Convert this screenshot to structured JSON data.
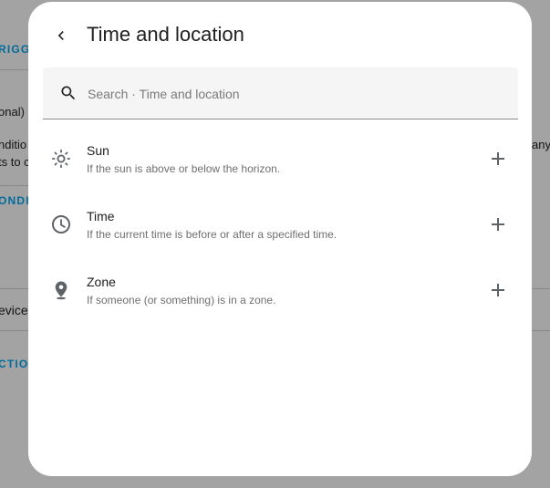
{
  "background": {
    "fragments": [
      {
        "text": "RIGGE"
      },
      {
        "text": "onal)"
      },
      {
        "text": "nditio"
      },
      {
        "text": "ts to c"
      },
      {
        "text": "ONDIT"
      },
      {
        "text": "evice"
      },
      {
        "text": "CTION"
      },
      {
        "text": "any"
      }
    ]
  },
  "dialog": {
    "title": "Time and location",
    "search": {
      "placeholder": "Search · Time and location",
      "value": ""
    },
    "items": [
      {
        "title": "Sun",
        "description": "If the sun is above or below the horizon.",
        "icon": "sun-icon"
      },
      {
        "title": "Time",
        "description": "If the current time is before or after a specified time.",
        "icon": "clock-icon"
      },
      {
        "title": "Zone",
        "description": "If someone (or something) is in a zone.",
        "icon": "map-marker-icon"
      }
    ]
  },
  "colors": {
    "accent": "#03a9f4",
    "scrim": "#000000",
    "surface": "#ffffff",
    "text_primary": "#212121",
    "text_secondary": "#6f6f6f",
    "icon": "#5f6368"
  }
}
